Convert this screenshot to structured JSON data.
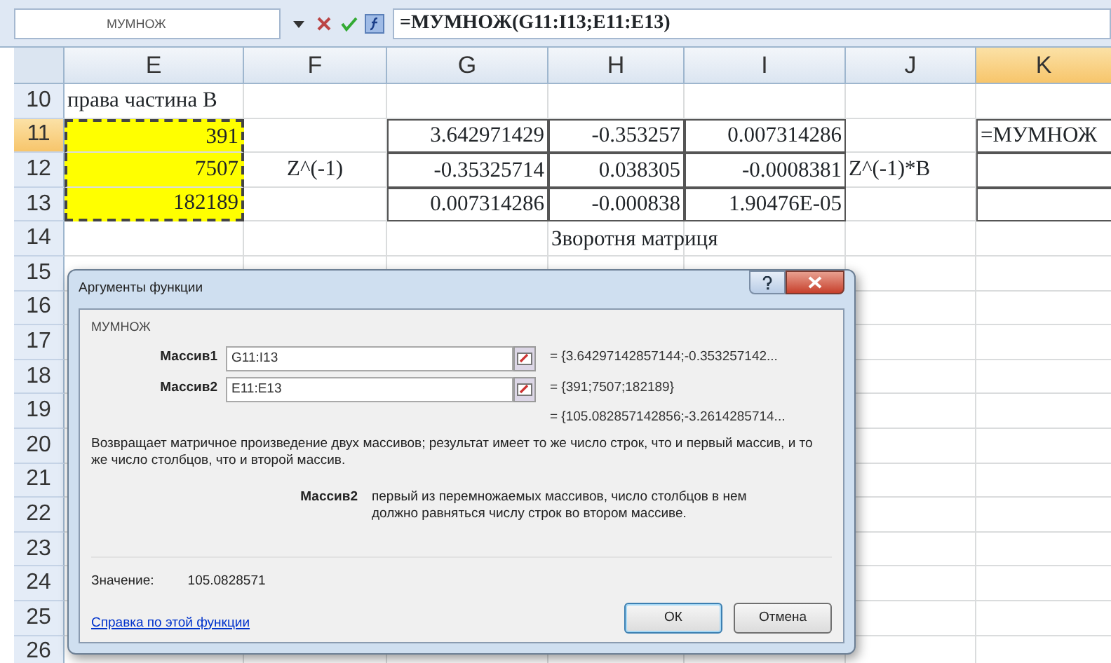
{
  "formula_bar": {
    "name_box": "МУМНОЖ",
    "formula": "=МУМНОЖ(G11:I13;E11:E13)"
  },
  "columns": [
    {
      "label": "E",
      "selected": false
    },
    {
      "label": "F",
      "selected": false
    },
    {
      "label": "G",
      "selected": false
    },
    {
      "label": "H",
      "selected": false
    },
    {
      "label": "I",
      "selected": false
    },
    {
      "label": "J",
      "selected": false
    },
    {
      "label": "K",
      "selected": true
    }
  ],
  "rows": [
    {
      "label": "10",
      "selected": false,
      "cells": [
        {
          "text": "права частина В",
          "kind": "text"
        },
        {},
        {},
        {},
        {},
        {},
        {}
      ]
    },
    {
      "label": "11",
      "selected": true,
      "cells": [
        {
          "text": "391",
          "kind": "number",
          "copy_range": true
        },
        {},
        {
          "text": "3.642971429",
          "kind": "number",
          "boxed": true
        },
        {
          "text": "-0.353257",
          "kind": "number",
          "boxed": true
        },
        {
          "text": "0.007314286",
          "kind": "number",
          "boxed": true
        },
        {},
        {
          "text": "=МУМНОЖ",
          "kind": "text",
          "boxed": true
        }
      ]
    },
    {
      "label": "12",
      "selected": false,
      "cells": [
        {
          "text": "7507",
          "kind": "number",
          "copy_range": true
        },
        {
          "text": "Z^(-1)",
          "kind": "label"
        },
        {
          "text": "-0.35325714",
          "kind": "number",
          "boxed": true
        },
        {
          "text": "0.038305",
          "kind": "number",
          "boxed": true
        },
        {
          "text": "-0.0008381",
          "kind": "number",
          "boxed": true
        },
        {
          "text": "Z^(-1)*B",
          "kind": "text"
        },
        {
          "kind": "text",
          "boxed": true
        }
      ]
    },
    {
      "label": "13",
      "selected": false,
      "cells": [
        {
          "text": "182189",
          "kind": "number",
          "copy_range": true
        },
        {},
        {
          "text": "0.007314286",
          "kind": "number",
          "boxed": true
        },
        {
          "text": "-0.000838",
          "kind": "number",
          "boxed": true
        },
        {
          "text": "1.90476E-05",
          "kind": "number",
          "boxed": true
        },
        {},
        {
          "kind": "text",
          "boxed": true
        }
      ]
    },
    {
      "label": "14",
      "selected": false,
      "cells": [
        {},
        {},
        {},
        {
          "text": "Зворотня матриця",
          "kind": "text"
        },
        {},
        {},
        {}
      ]
    },
    {
      "label": "15",
      "selected": false,
      "cells": [
        {},
        {},
        {},
        {},
        {},
        {},
        {}
      ]
    },
    {
      "label": "16",
      "selected": false,
      "cells": [
        {},
        {},
        {},
        {},
        {},
        {},
        {}
      ]
    },
    {
      "label": "17",
      "selected": false,
      "cells": [
        {},
        {},
        {},
        {},
        {},
        {},
        {}
      ]
    },
    {
      "label": "18",
      "selected": false,
      "cells": [
        {},
        {},
        {},
        {},
        {},
        {},
        {}
      ]
    },
    {
      "label": "19",
      "selected": false,
      "cells": [
        {},
        {},
        {},
        {},
        {},
        {},
        {}
      ]
    },
    {
      "label": "20",
      "selected": false,
      "cells": [
        {},
        {},
        {},
        {},
        {},
        {},
        {}
      ]
    },
    {
      "label": "21",
      "selected": false,
      "cells": [
        {},
        {},
        {},
        {},
        {},
        {},
        {}
      ]
    },
    {
      "label": "22",
      "selected": false,
      "cells": [
        {},
        {},
        {},
        {},
        {},
        {},
        {}
      ]
    },
    {
      "label": "23",
      "selected": false,
      "cells": [
        {},
        {},
        {},
        {},
        {},
        {},
        {}
      ]
    },
    {
      "label": "24",
      "selected": false,
      "cells": [
        {},
        {},
        {},
        {},
        {},
        {},
        {}
      ]
    },
    {
      "label": "25",
      "selected": false,
      "cells": [
        {},
        {},
        {},
        {},
        {},
        {},
        {}
      ]
    },
    {
      "label": "26",
      "selected": false,
      "cells": [
        {},
        {},
        {},
        {},
        {},
        {},
        {}
      ]
    }
  ],
  "dialog": {
    "title": "Аргументы функции",
    "function_name": "МУМНОЖ",
    "arguments": [
      {
        "label": "Массив1",
        "value": "G11:I13",
        "result": "= {3.64297142857144;-0.353257142..."
      },
      {
        "label": "Массив2",
        "value": "E11:E13",
        "result": "= {391;7507;182189}"
      }
    ],
    "formula_result": "= {105.082857142856;-3.2614285714...",
    "description": "Возвращает матричное произведение двух массивов; результат имеет то же число строк, что и первый массив, и то же число столбцов, что и второй массив.",
    "argument_help": {
      "label": "Массив2",
      "text": "первый из перемножаемых массивов, число столбцов в нем должно равняться числу строк во втором массиве."
    },
    "value_label": "Значение:",
    "value": "105.0828571",
    "help_link": "Справка по этой функции",
    "buttons": [
      "ОК",
      "Отмена"
    ]
  }
}
